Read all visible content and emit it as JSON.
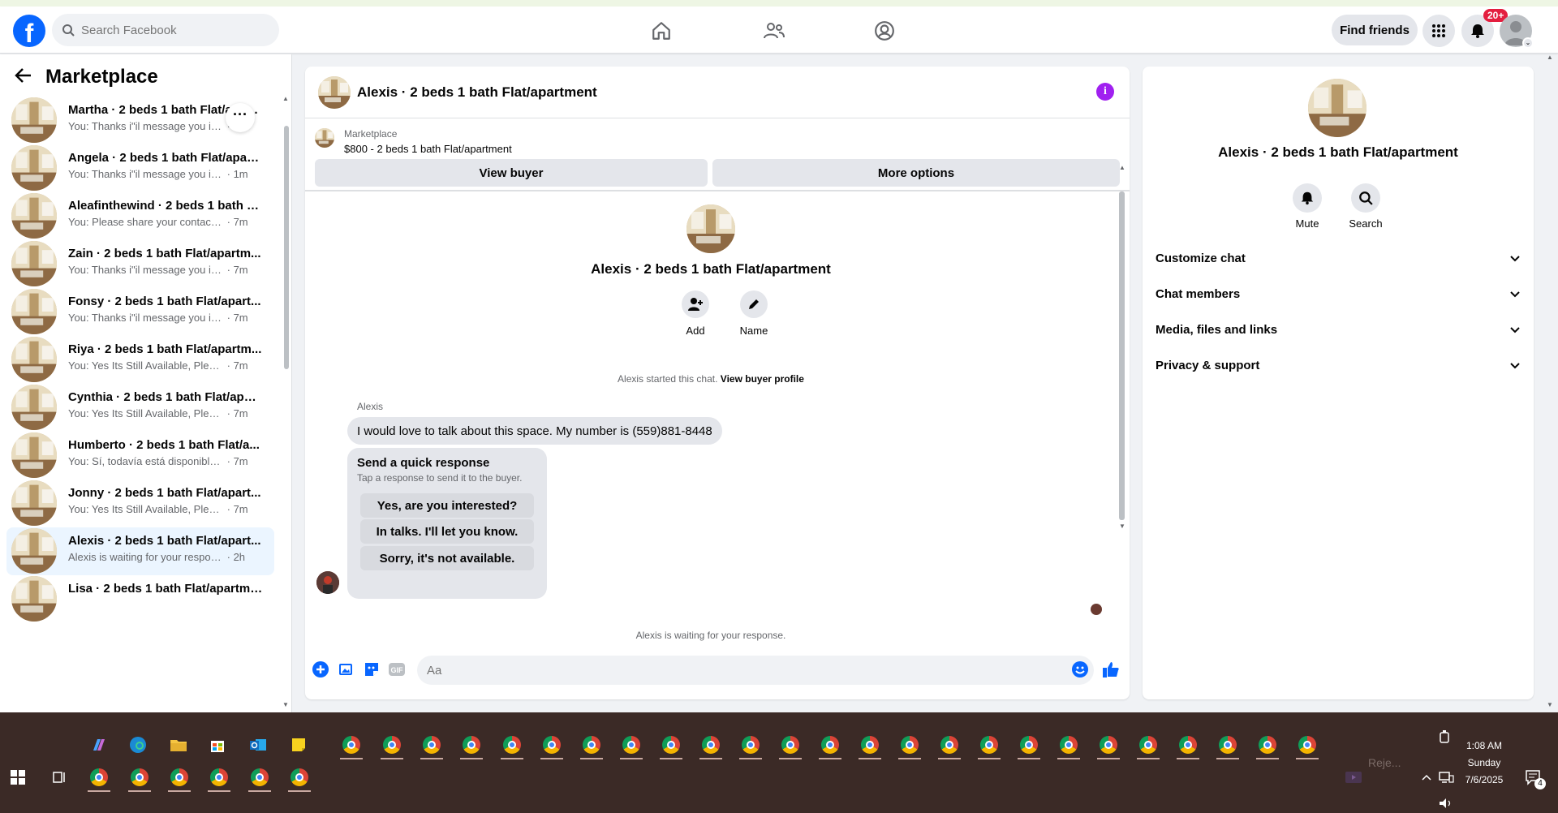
{
  "header": {
    "search_placeholder": "Search Facebook",
    "find_friends": "Find friends",
    "notification_count": "20+",
    "logo_letter": "f"
  },
  "sidebar": {
    "title": "Marketplace",
    "conversations": [
      {
        "name": "Martha · 2 beds 1 bath Flat/apartment",
        "snippet": "You: Thanks i\"il message you in a bit",
        "time": "m"
      },
      {
        "name": "Angela · 2 beds 1 bath Flat/apart...",
        "snippet": "You: Thanks i\"il message you in a ...",
        "time": "1m"
      },
      {
        "name": "Aleafinthewind · 2 beds 1 bath Fl...",
        "snippet": "You: Please share your contact nu...",
        "time": "7m"
      },
      {
        "name": "Zain · 2 beds 1 bath Flat/apartm...",
        "snippet": "You: Thanks i\"il message you in a ...",
        "time": "7m"
      },
      {
        "name": "Fonsy · 2 beds 1 bath Flat/apart...",
        "snippet": "You: Thanks i\"il message you in a ...",
        "time": "7m"
      },
      {
        "name": "Riya · 2 beds 1 bath Flat/apartm...",
        "snippet": "You: Yes Its Still Available, Please S...",
        "time": "7m"
      },
      {
        "name": "Cynthia · 2 beds 1 bath Flat/apar...",
        "snippet": "You: Yes Its Still Available, Please S...",
        "time": "7m"
      },
      {
        "name": "Humberto · 2 beds 1 bath Flat/a...",
        "snippet": "You: Sí, todavía está disponible, en...",
        "time": "7m"
      },
      {
        "name": "Jonny · 2 beds 1 bath Flat/apart...",
        "snippet": "You: Yes Its Still Available, Please S...",
        "time": "7m"
      },
      {
        "name": "Alexis · 2 beds 1 bath Flat/apart...",
        "snippet": "Alexis is waiting for your response.....",
        "time": "2h"
      },
      {
        "name": "Lisa · 2 beds 1 bath Flat/apartme...",
        "snippet": "",
        "time": ""
      }
    ],
    "selected_index": 9
  },
  "chat": {
    "title": "Alexis · 2 beds 1 bath Flat/apartment",
    "marketplace_label": "Marketplace",
    "listing": "$800 - 2 beds 1 bath Flat/apartment",
    "view_buyer": "View buyer",
    "more_options": "More options",
    "center_name": "Alexis · 2 beds 1 bath Flat/apartment",
    "add_label": "Add",
    "name_label": "Name",
    "started_text": "Alexis started this chat.",
    "view_buyer_profile": "View buyer profile",
    "sender": "Alexis",
    "message": "I would love to talk about this space. My number is (559)881-8448",
    "quick_title": "Send a quick response",
    "quick_sub": "Tap a response to send it to the buyer.",
    "quick_responses": [
      "Yes, are you interested?",
      "In talks. I'll let you know.",
      "Sorry, it's not available."
    ],
    "waiting": "Alexis is waiting for your response.",
    "composer_placeholder": "Aa",
    "gif_label": "GIF"
  },
  "details": {
    "name": "Alexis · 2 beds 1 bath Flat/apartment",
    "mute": "Mute",
    "search": "Search",
    "sections": [
      "Customize chat",
      "Chat members",
      "Media, files and links",
      "Privacy & support"
    ]
  },
  "taskbar": {
    "time": "1:08 AM",
    "day": "Sunday",
    "date": "7/6/2025",
    "tray_label": "Reje...",
    "notif_count": "4"
  },
  "colors": {
    "fb_blue": "#0866ff",
    "selected_bg": "#ebf5ff",
    "info_purple": "#a020f0",
    "badge_red": "#e41e3f",
    "taskbar": "#3b2a26"
  }
}
